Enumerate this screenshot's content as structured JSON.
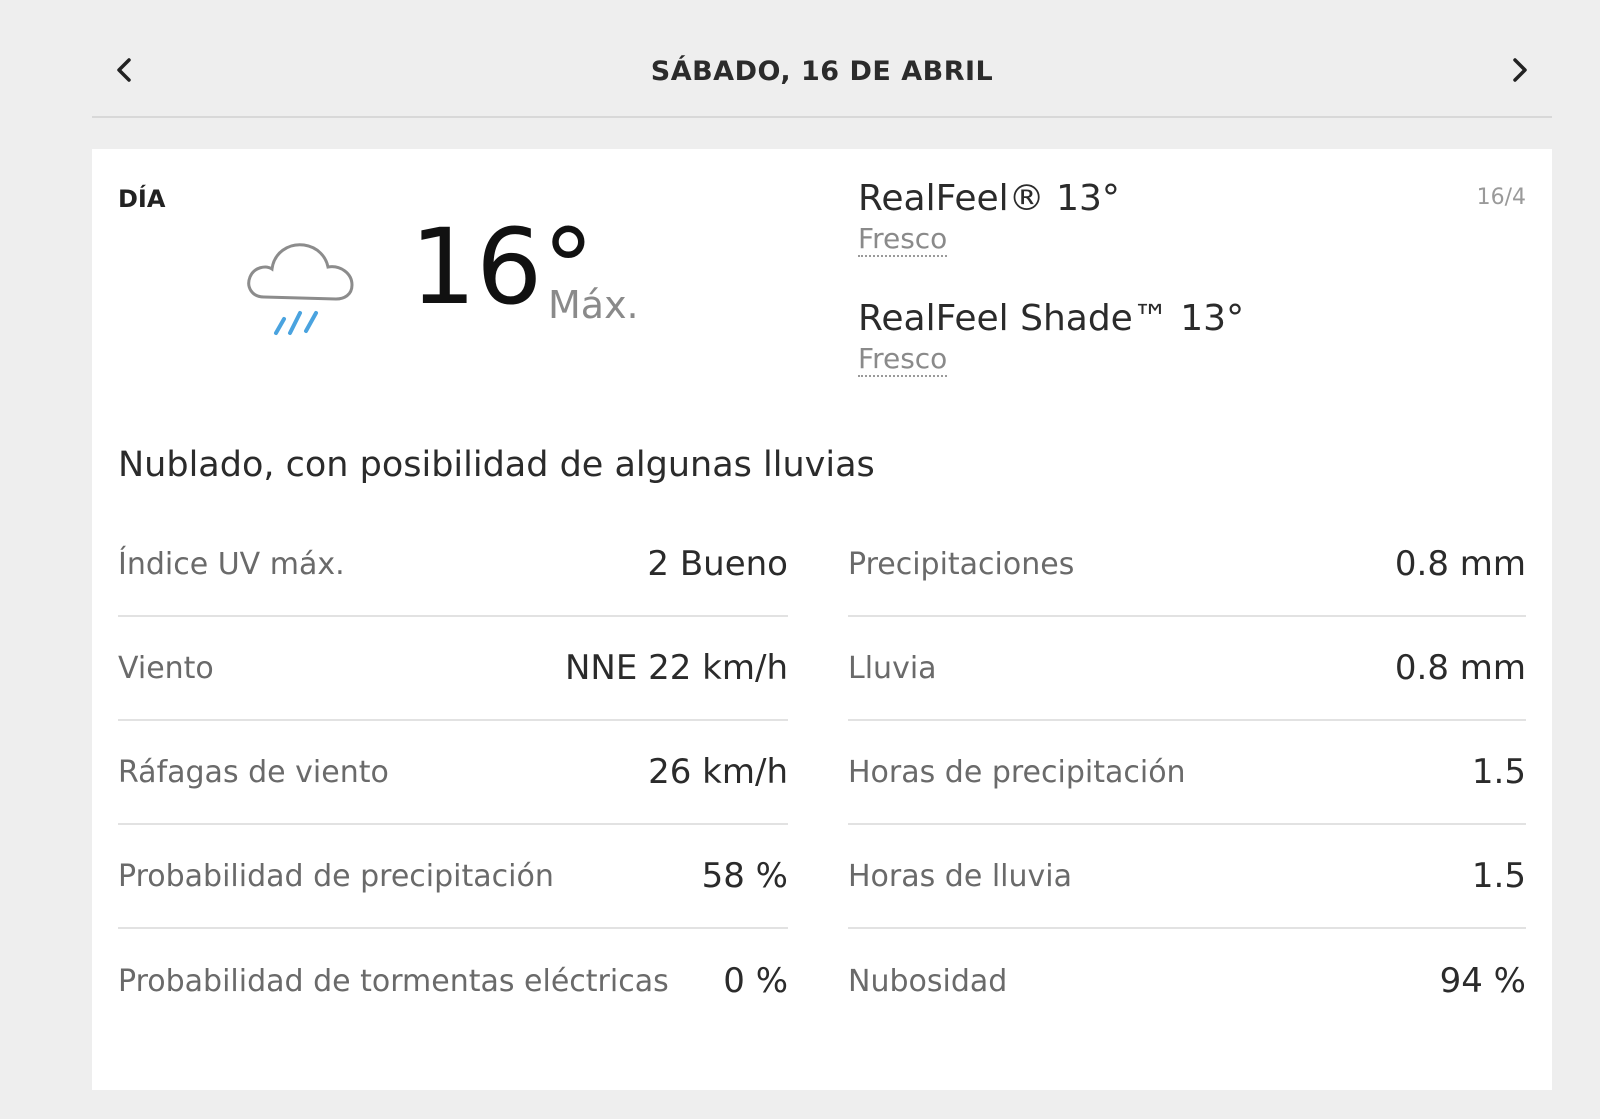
{
  "header": {
    "date_title": "SÁBADO, 16 DE ABRIL",
    "prev_icon": "chevron-left-icon",
    "next_icon": "chevron-right-icon"
  },
  "day": {
    "label": "DÍA",
    "date_short": "16/4",
    "icon": "cloud-rain-icon",
    "temperature": "16°",
    "temperature_label": "Máx.",
    "realfeel": {
      "value": "RealFeel® 13°",
      "desc": "Fresco"
    },
    "realfeel_shade": {
      "value": "RealFeel Shade™ 13°",
      "desc": "Fresco"
    },
    "phrase": "Nublado, con posibilidad de algunas lluvias"
  },
  "details_left": [
    {
      "label": "Índice UV máx.",
      "value": "2 Bueno"
    },
    {
      "label": "Viento",
      "value": "NNE 22 km/h"
    },
    {
      "label": "Ráfagas de viento",
      "value": "26 km/h"
    },
    {
      "label": "Probabilidad de precipitación",
      "value": "58 %"
    },
    {
      "label": "Probabilidad de tormentas eléctricas",
      "value": "0 %"
    }
  ],
  "details_right": [
    {
      "label": "Precipitaciones",
      "value": "0.8 mm"
    },
    {
      "label": "Lluvia",
      "value": "0.8 mm"
    },
    {
      "label": "Horas de precipitación",
      "value": "1.5"
    },
    {
      "label": "Horas de lluvia",
      "value": "1.5"
    },
    {
      "label": "Nubosidad",
      "value": "94 %"
    }
  ],
  "colors": {
    "background": "#eeeeee",
    "card": "#ffffff",
    "rain_accent": "#4aa3df"
  }
}
